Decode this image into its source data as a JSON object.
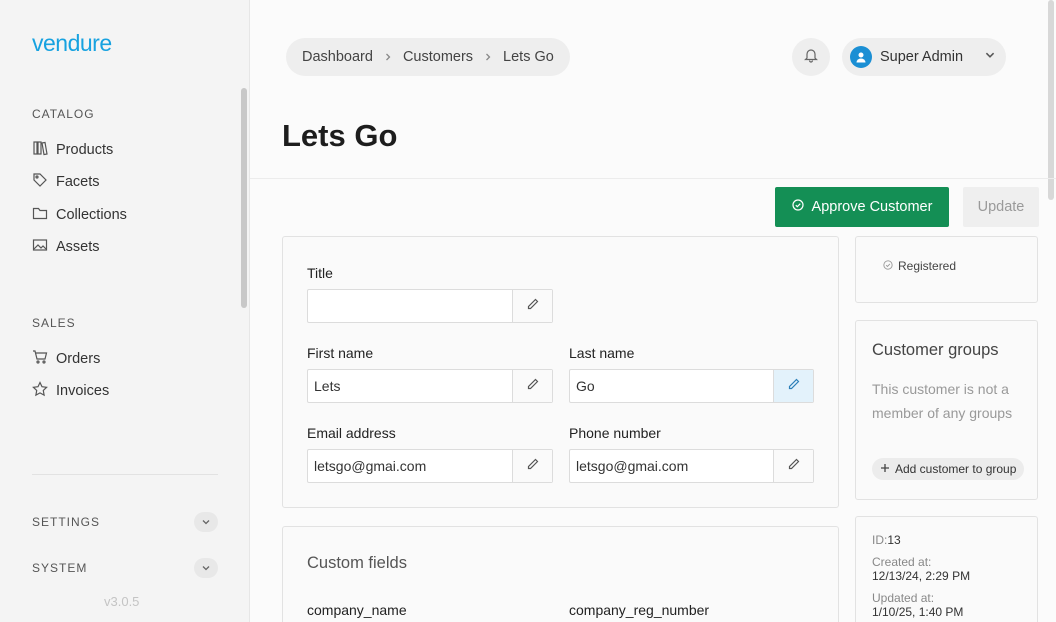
{
  "sidebar": {
    "logo": "vendure",
    "catalog_title": "CATALOG",
    "catalog_items": [
      {
        "label": "Products",
        "icon": "book-icon"
      },
      {
        "label": "Facets",
        "icon": "tag-icon"
      },
      {
        "label": "Collections",
        "icon": "folder-icon"
      },
      {
        "label": "Assets",
        "icon": "image-icon"
      }
    ],
    "sales_title": "SALES",
    "sales_items": [
      {
        "label": "Orders",
        "icon": "cart-icon"
      },
      {
        "label": "Invoices",
        "icon": "star-icon"
      }
    ],
    "settings_label": "SETTINGS",
    "system_label": "SYSTEM",
    "version": "v3.0.5"
  },
  "header": {
    "breadcrumb": [
      "Dashboard",
      "Customers",
      "Lets Go"
    ],
    "user_name": "Super Admin"
  },
  "page": {
    "title": "Lets Go",
    "approve_label": "Approve Customer",
    "update_label": "Update"
  },
  "form": {
    "title_label": "Title",
    "title_value": "",
    "first_name_label": "First name",
    "first_name_value": "Lets",
    "last_name_label": "Last name",
    "last_name_value": "Go",
    "email_label": "Email address",
    "email_value": "letsgo@gmai.com",
    "phone_label": "Phone number",
    "phone_value": "letsgo@gmai.com"
  },
  "custom_fields": {
    "title": "Custom fields",
    "company_name_label": "company_name",
    "company_reg_label": "company_reg_number"
  },
  "status": {
    "label": "Registered"
  },
  "customer_groups": {
    "title": "Customer groups",
    "empty_text": "This customer is not a member of any groups",
    "add_label": "Add customer to group"
  },
  "meta": {
    "id_label": "ID:",
    "id_value": "13",
    "created_label": "Created at:",
    "created_value": "12/13/24, 2:29 PM",
    "updated_label": "Updated at:",
    "updated_value": "1/10/25, 1:40 PM"
  },
  "colors": {
    "brand": "#17a2e0",
    "approve": "#148f55"
  }
}
